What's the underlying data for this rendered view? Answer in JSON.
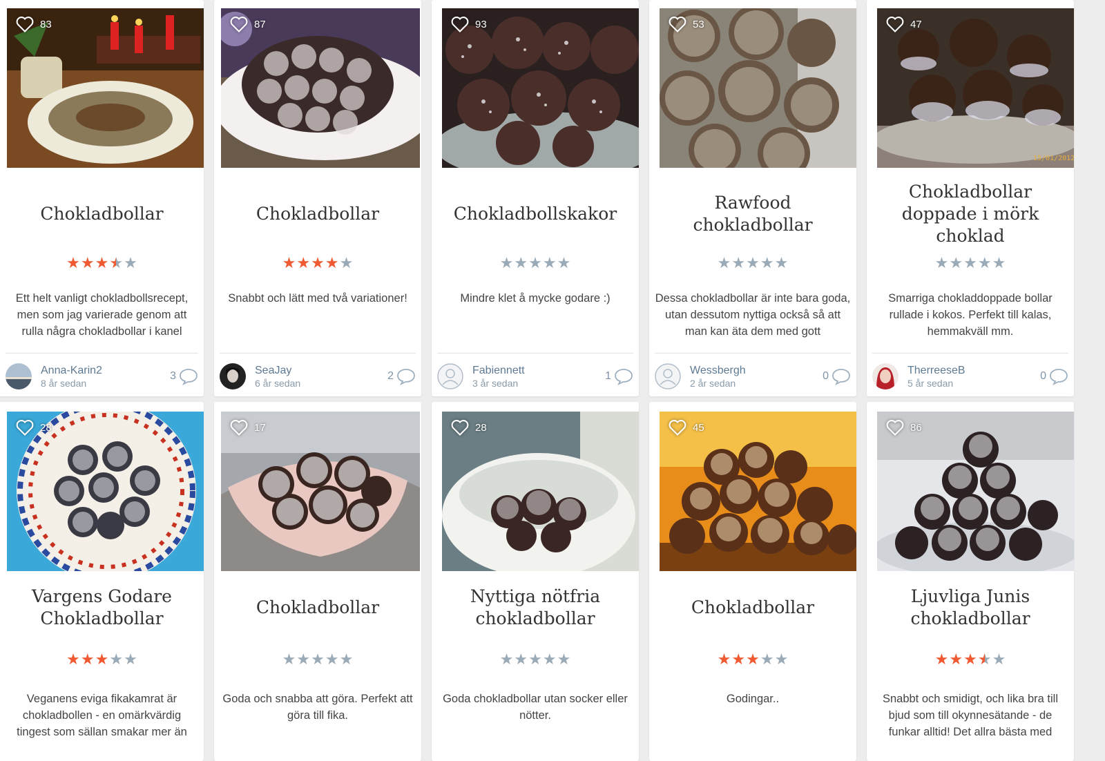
{
  "colors": {
    "background": "#ededed",
    "star_on": "#ef5a32",
    "star_off": "#9aaab7",
    "author": "#5e7a93"
  },
  "icons": {
    "like": "heart-outline-icon",
    "comments": "speech-bubble-icon",
    "default_avatar": "user-silhouette-icon"
  },
  "recipes": [
    {
      "likes": "83",
      "title": "Chokladbollar",
      "rating": 3.5,
      "description": "Ett helt vanligt chokladbollsrecept, men som jag varierade genom att rulla några chokladbollar i kanel",
      "author": "Anna-Karin2",
      "time": "8 år sedan",
      "comments": "3"
    },
    {
      "likes": "87",
      "title": "Chokladbollar",
      "rating": 4,
      "description": "Snabbt och lätt med två variationer!",
      "author": "SeaJay",
      "time": "6 år sedan",
      "comments": "2"
    },
    {
      "likes": "93",
      "title": "Chokladbollskakor",
      "rating": 0,
      "description": "Mindre klet å mycke godare :)",
      "author": "Fabiennett",
      "time": "3 år sedan",
      "comments": "1"
    },
    {
      "likes": "53",
      "title": "Rawfood chokladbollar",
      "rating": 0,
      "description": "Dessa chokladbollar är inte bara goda, utan dessutom nyttiga också så att man kan äta dem med gott",
      "author": "Wessbergh",
      "time": "2 år sedan",
      "comments": "0"
    },
    {
      "likes": "47",
      "title": "Chokladbollar doppade i mörk choklad",
      "rating": 0,
      "description": "Smarriga chokladdoppade bollar rullade i kokos. Perfekt till kalas, hemmakväll mm.",
      "author": "TherreeseB",
      "time": "5 år sedan",
      "comments": "0"
    },
    {
      "likes": "28",
      "title": "Vargens Godare Chokladbollar",
      "rating": 3,
      "description": "Veganens eviga fikakamrat är chokladbollen - en omärkvärdig tingest som sällan smakar mer än"
    },
    {
      "likes": "17",
      "title": "Chokladbollar",
      "rating": 0,
      "description": "Goda och snabba att göra. Perfekt att göra till fika."
    },
    {
      "likes": "28",
      "title": "Nyttiga nötfria chokladbollar",
      "rating": 0,
      "description": "Goda chokladbollar utan socker eller nötter."
    },
    {
      "likes": "45",
      "title": "Chokladbollar",
      "rating": 3,
      "description": "Godingar.."
    },
    {
      "likes": "86",
      "title": "Ljuvliga Junis chokladbollar",
      "rating": 3.5,
      "description": "Snabbt och smidigt, och lika bra till bjud som till okynnesätande - de funkar alltid! Det allra bästa med"
    }
  ]
}
